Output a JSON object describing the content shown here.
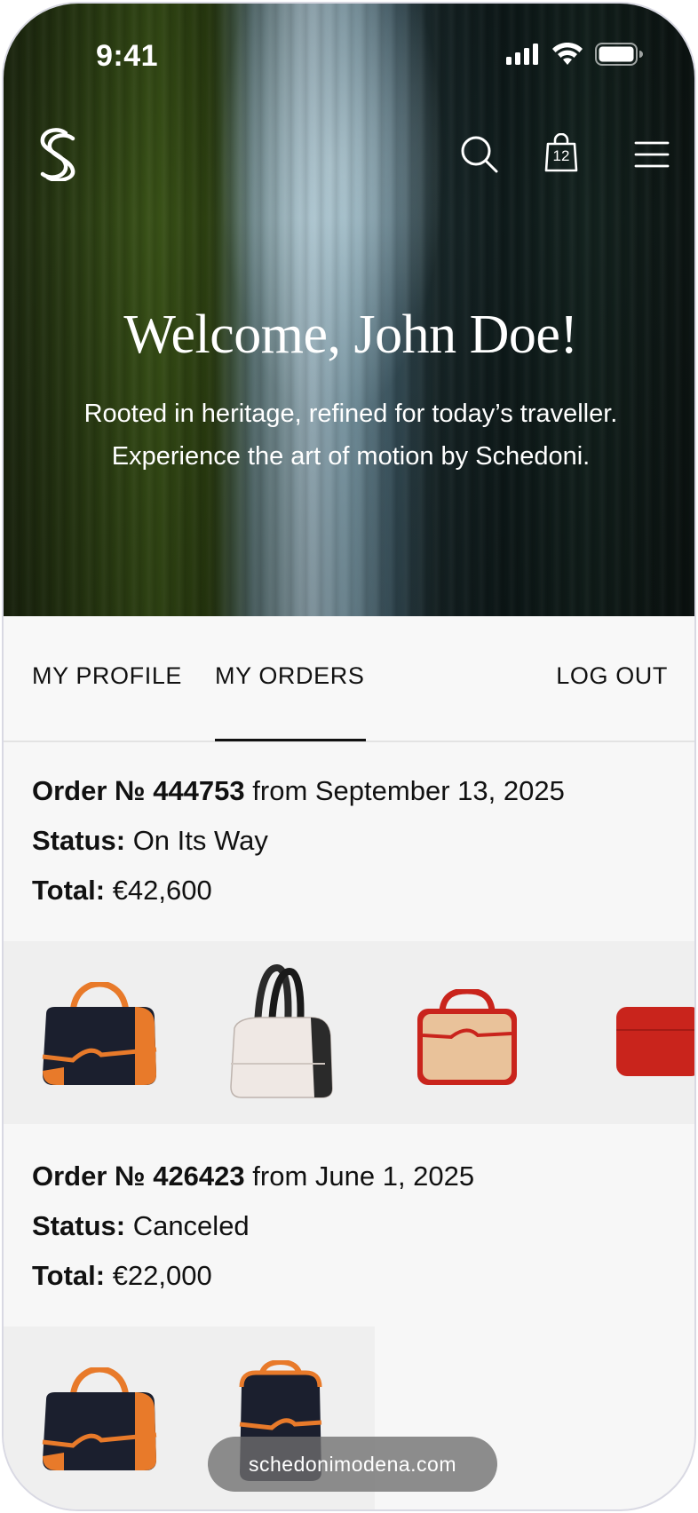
{
  "status_bar": {
    "time": "9:41",
    "icons": [
      "cellular-signal-icon",
      "wifi-icon",
      "battery-icon"
    ]
  },
  "nav": {
    "logo": "schedoni-logo",
    "icons": [
      "search-icon",
      "shopping-bag-icon",
      "hamburger-menu-icon"
    ],
    "bag_count": "12"
  },
  "hero": {
    "title": "Welcome, John Doe!",
    "subtitle_line1": "Rooted in heritage, refined for today’s traveller.",
    "subtitle_line2": "Experience the art of motion by Schedoni."
  },
  "tabs": [
    {
      "label": "MY PROFILE",
      "active": false
    },
    {
      "label": "MY ORDERS",
      "active": true
    },
    {
      "label": "LOG OUT",
      "active": false
    }
  ],
  "orders": [
    {
      "number_label": "Order № 444753",
      "date_text": " from September 13, 2025",
      "status_label": "Status:",
      "status_value": " On Its Way",
      "total_label": "Total:",
      "total_value": " €42,600",
      "items": [
        "navy-orange-duffel-bag",
        "white-black-shoulder-bag",
        "beige-red-travel-case",
        "red-leather-case"
      ]
    },
    {
      "number_label": "Order № 426423",
      "date_text": " from June 1, 2025",
      "status_label": "Status:",
      "status_value": " Canceled",
      "total_label": "Total:",
      "total_value": " €22,000",
      "items": [
        "navy-orange-duffel-bag",
        "navy-orange-backpack"
      ]
    }
  ],
  "url_pill": "schedonimodena.com",
  "colors": {
    "bag_navy": "#1b1f2e",
    "bag_orange": "#e87a2a",
    "bag_red": "#c9241c",
    "bag_beige": "#e9c29a",
    "page_bg": "#f7f7f7"
  }
}
